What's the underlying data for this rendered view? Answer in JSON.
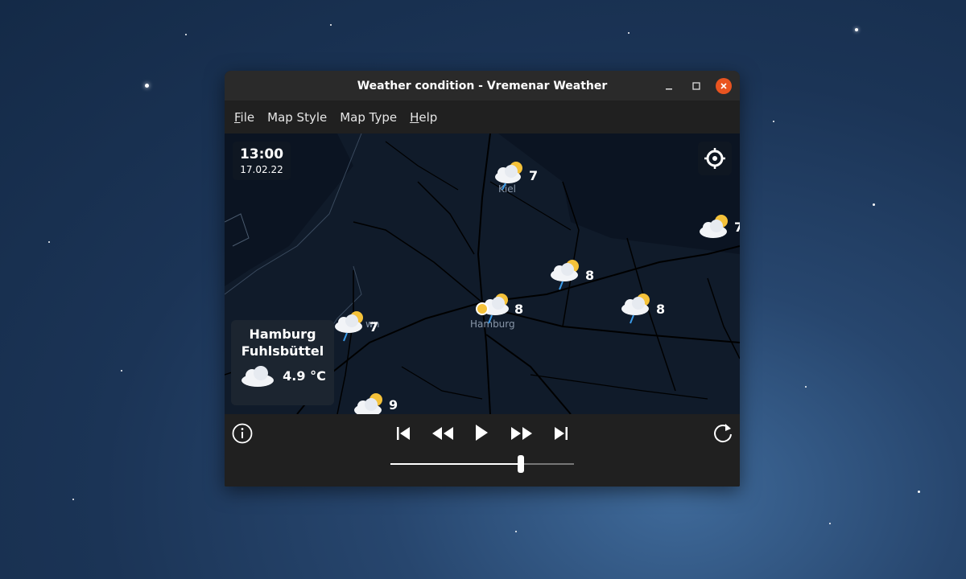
{
  "window": {
    "title": "Weather condition - Vremenar Weather",
    "controls": [
      "minimize-icon",
      "maximize-icon",
      "close-icon"
    ]
  },
  "menu": {
    "file": {
      "first": "F",
      "rest": "ile"
    },
    "map_style": "Map Style",
    "map_type": "Map Type",
    "help": {
      "first": "H",
      "rest": "elp"
    }
  },
  "map": {
    "time": "13:00",
    "date": "17.02.22",
    "place_labels": [
      "Kiel",
      "Hamburg",
      "wn"
    ],
    "markers": [
      {
        "icon": "partly-cloudy-rain-icon",
        "value": "7"
      },
      {
        "icon": "partly-cloudy-icon",
        "value": "7"
      },
      {
        "icon": "partly-cloudy-rain-icon",
        "value": "8"
      },
      {
        "icon": "partly-cloudy-rain-icon",
        "value": "8"
      },
      {
        "icon": "partly-cloudy-rain-icon",
        "value": "8"
      },
      {
        "icon": "partly-cloudy-rain-icon",
        "value": "7"
      },
      {
        "icon": "partly-cloudy-icon",
        "value": "9"
      }
    ],
    "selected_station": {
      "name_line1": "Hamburg",
      "name_line2": "Fuhlsbüttel",
      "icon": "cloudy-icon",
      "temperature": "4.9 °C"
    }
  },
  "playback": {
    "buttons": [
      "info-icon",
      "skip-first-icon",
      "rewind-icon",
      "play-icon",
      "fast-forward-icon",
      "skip-last-icon",
      "refresh-icon"
    ],
    "timeline_position": 0.71
  },
  "colors": {
    "close_button": "#e95420",
    "map_background": "#101b2a"
  }
}
